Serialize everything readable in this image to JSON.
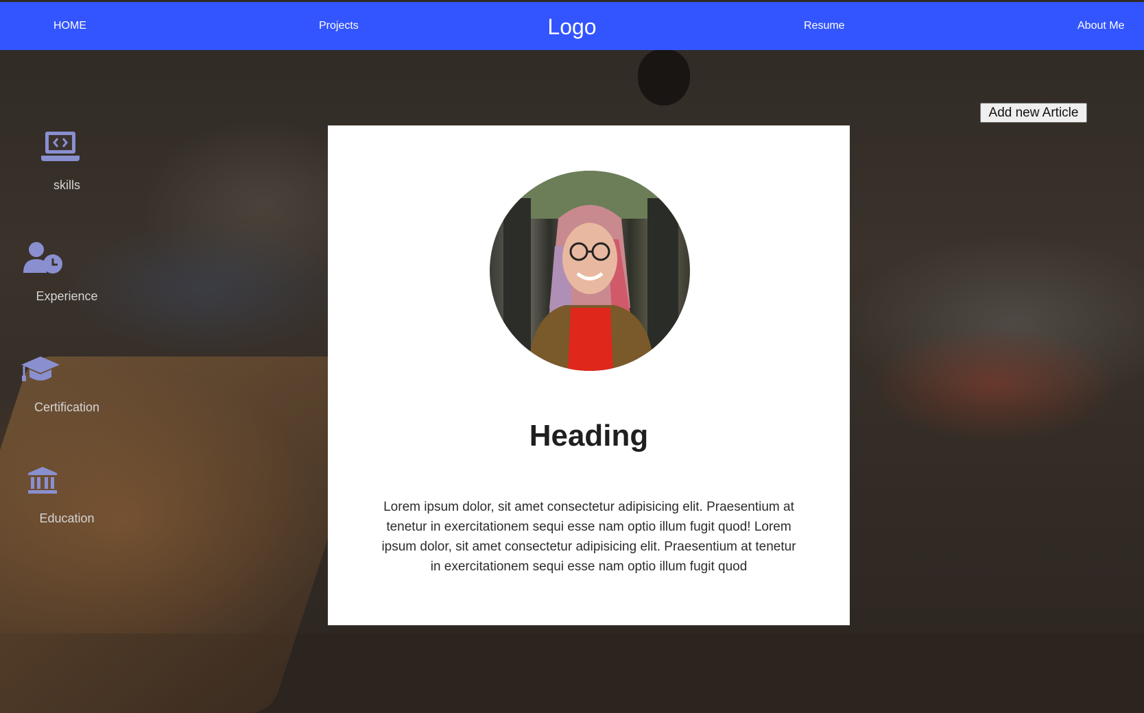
{
  "nav": {
    "home": "HOME",
    "projects": "Projects",
    "logo": "Logo",
    "resume": "Resume",
    "about": "About Me"
  },
  "actions": {
    "add_article": "Add new Article"
  },
  "sidebar": {
    "items": [
      {
        "label": "skills",
        "icon": "laptop-code-icon"
      },
      {
        "label": "Experience",
        "icon": "user-clock-icon"
      },
      {
        "label": "Certification",
        "icon": "graduation-cap-icon"
      },
      {
        "label": "Education",
        "icon": "university-icon"
      }
    ]
  },
  "card": {
    "heading": "Heading",
    "text": "Lorem ipsum dolor, sit amet consectetur adipisicing elit. Praesentium at tenetur in exercitationem sequi esse nam optio illum fugit quod! Lorem ipsum dolor, sit amet consectetur adipisicing elit. Praesentium at tenetur in exercitationem sequi esse nam optio illum fugit quod"
  },
  "colors": {
    "navbar": "#3355ff",
    "icon": "#8a8fd0",
    "sidebar_text": "#d5d5d5",
    "card": "#ffffff"
  }
}
